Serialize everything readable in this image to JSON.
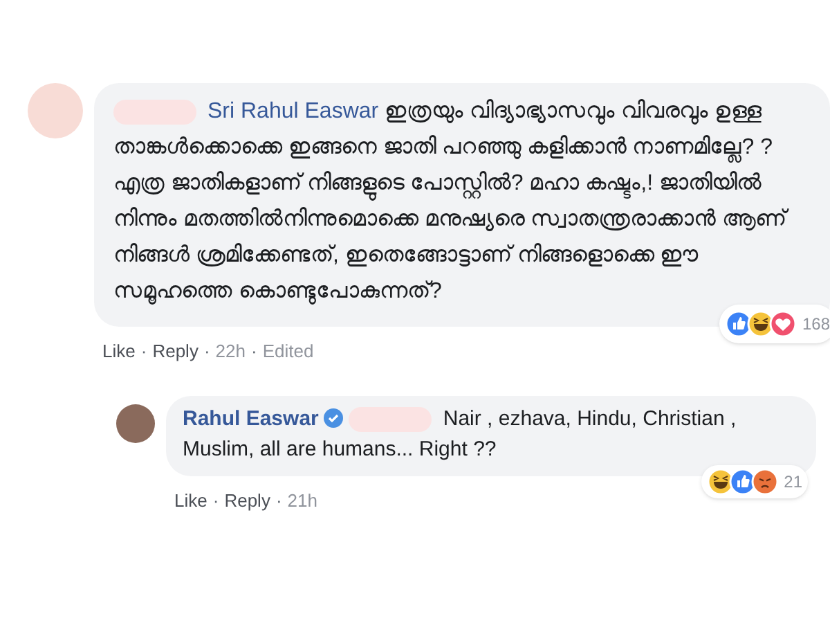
{
  "comments": [
    {
      "author_redacted": true,
      "verified": false,
      "mention": "Sri Rahul Easwar",
      "text": "ഇത്രയും വിദ്യാഭ്യാസവും വിവരവും ഉള്ള താങ്കൾക്കൊക്കെ ഇങ്ങനെ ജാതി പറഞ്ഞു കളിക്കാൻ നാണമില്ലേ? ? എത്ര ജാതികളാണ് നിങ്ങളുടെ പോസ്റ്റിൽ? മഹാ കഷ്ടം,! ജാതിയിൽ നിന്നും മതത്തിൽനിന്നുമൊക്കെ മനുഷ്യരെ സ്വാതന്ത്രരാക്കാൻ ആണ് നിങ്ങൾ ശ്രമിക്കേണ്ടത്, ഇതെങ്ങോട്ടാണ് നിങ്ങളൊക്കെ ഈ സമൂഹത്തെ കൊണ്ടുപോകുന്നത്?",
      "reactions": [
        {
          "kind": "like"
        },
        {
          "kind": "haha"
        },
        {
          "kind": "love"
        }
      ],
      "reaction_count": "168",
      "actions": [
        "Like",
        "Reply",
        "22h",
        "Edited"
      ],
      "separator": "·"
    },
    {
      "author": "Rahul Easwar",
      "verified": true,
      "mention_redacted": true,
      "text": "Nair , ezhava, Hindu, Christian , Muslim, all are humans... Right ??",
      "reactions": [
        {
          "kind": "haha"
        },
        {
          "kind": "like"
        },
        {
          "kind": "angry"
        }
      ],
      "reaction_count": "21",
      "actions": [
        "Like",
        "Reply",
        "21h"
      ],
      "separator": "·"
    }
  ]
}
